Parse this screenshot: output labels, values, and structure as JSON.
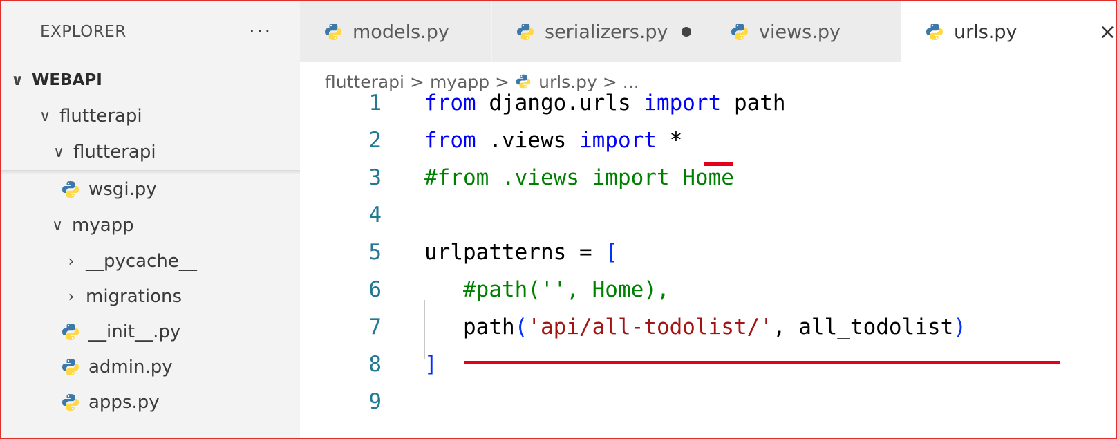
{
  "sidebar": {
    "title": "EXPLORER",
    "more_label": "···",
    "root": {
      "chevron": "∨",
      "label": "WEBAPI"
    },
    "items": [
      {
        "kind": "folder",
        "chevron": "∨",
        "label": "flutterapi"
      },
      {
        "kind": "folder",
        "chevron": "∨",
        "label": "flutterapi"
      },
      {
        "kind": "file",
        "icon": "python-file-icon",
        "label": "wsgi.py"
      },
      {
        "kind": "folder",
        "chevron": "∨",
        "label": "myapp"
      },
      {
        "kind": "folder",
        "chevron": "›",
        "label": "__pycache__"
      },
      {
        "kind": "folder",
        "chevron": "›",
        "label": "migrations"
      },
      {
        "kind": "file",
        "icon": "python-file-icon",
        "label": "__init__.py"
      },
      {
        "kind": "file",
        "icon": "python-file-icon",
        "label": "admin.py"
      },
      {
        "kind": "file",
        "icon": "python-file-icon",
        "label": "apps.py"
      }
    ]
  },
  "tabs": [
    {
      "label": "models.py",
      "active": false,
      "modified": false
    },
    {
      "label": "serializers.py",
      "active": false,
      "modified": true
    },
    {
      "label": "views.py",
      "active": false,
      "modified": false
    },
    {
      "label": "urls.py",
      "active": true,
      "modified": false,
      "close": "×"
    }
  ],
  "breadcrumb": {
    "parts": [
      "flutterapi",
      "myapp",
      "urls.py",
      "..."
    ],
    "separator": ">"
  },
  "code": {
    "line_numbers": [
      "1",
      "2",
      "3",
      "4",
      "5",
      "6",
      "7",
      "8",
      "9"
    ],
    "lines": [
      [
        [
          "kw",
          "from"
        ],
        [
          "pn",
          " django.urls "
        ],
        [
          "kw",
          "import"
        ],
        [
          "pn",
          " path"
        ]
      ],
      [
        [
          "kw",
          "from"
        ],
        [
          "pn",
          " .views "
        ],
        [
          "kw",
          "import"
        ],
        [
          "pn",
          " *"
        ]
      ],
      [
        [
          "cm",
          "#from .views import Home"
        ]
      ],
      [],
      [
        [
          "pn",
          "urlpatterns = "
        ],
        [
          "br",
          "["
        ]
      ],
      [
        [
          "pn",
          "   "
        ],
        [
          "cm",
          "#path('', Home),"
        ]
      ],
      [
        [
          "pn",
          "   path"
        ],
        [
          "br",
          "("
        ],
        [
          "str",
          "'api/all-todolist/'"
        ],
        [
          "pn",
          ", all_todolist"
        ],
        [
          "br",
          ")"
        ]
      ],
      [
        [
          "br",
          "]"
        ]
      ],
      []
    ]
  },
  "colors": {
    "keyword": "#0000ff",
    "comment": "#008000",
    "string": "#a31515",
    "line_number": "#237893",
    "annotation": "#e2001a",
    "python_icon_blue": "#3c78aa",
    "python_icon_yellow": "#ffd845"
  }
}
